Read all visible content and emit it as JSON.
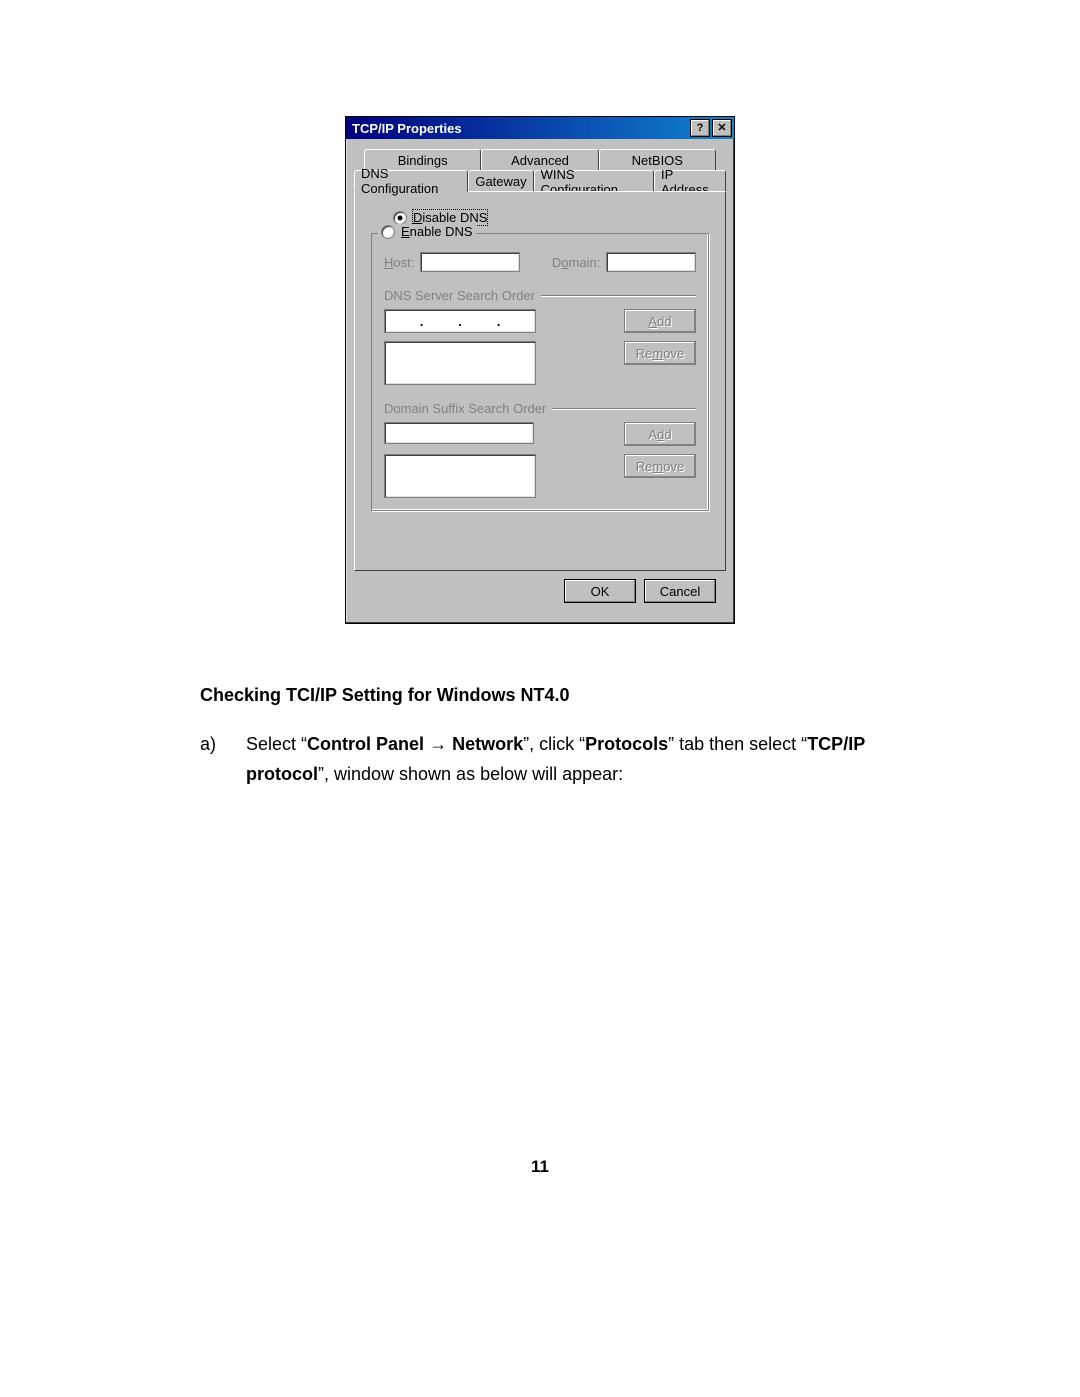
{
  "dialog": {
    "title": "TCP/IP Properties",
    "help_glyph": "?",
    "close_glyph": "✕",
    "tabs_back": [
      "Bindings",
      "Advanced",
      "NetBIOS"
    ],
    "tabs_front": [
      "DNS Configuration",
      "Gateway",
      "WINS Configuration",
      "IP Address"
    ],
    "active_tab": "DNS Configuration",
    "radio_disable": "Disable DNS",
    "radio_enable": "Enable DNS",
    "host_label": "Host:",
    "domain_label": "Domain:",
    "dns_search_label": "DNS Server Search Order",
    "domain_suffix_label": "Domain Suffix Search Order",
    "add_label": "Add",
    "remove_label": "Remove",
    "ok_label": "OK",
    "cancel_label": "Cancel"
  },
  "doc": {
    "heading": "Checking TCI/IP Setting for Windows NT4.0",
    "list_marker": "a)",
    "t1": "Select “",
    "t2": "Control Panel",
    "arrow": "→",
    "t3": "Network",
    "t4": "”, click “",
    "t5": "Protocols",
    "t6": "” tab then select “",
    "t7": "TCP/IP protocol",
    "t8": "”, window shown as below will appear:"
  },
  "page_number": "11"
}
